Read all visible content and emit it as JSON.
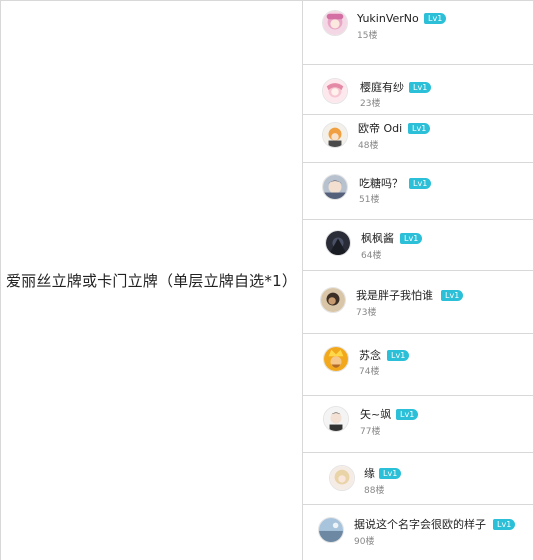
{
  "prize": "爱丽丝立牌或卡门立牌（单层立牌自选*1）",
  "winners": [
    {
      "name": "YukinVerNo",
      "level": "Lv1",
      "floor": "15楼",
      "avatar": "anime-girl-pink-hair-avatar"
    },
    {
      "name": "樱庭有纱",
      "level": "Lv1",
      "floor": "23楼",
      "avatar": "anime-girl-pink-avatar"
    },
    {
      "name": "欧帝 Odi",
      "level": "Lv1",
      "floor": "48楼",
      "avatar": "anime-character-orange-avatar"
    },
    {
      "name": "吃糖吗？",
      "level": "Lv1",
      "floor": "51楼",
      "avatar": "anime-boy-avatar"
    },
    {
      "name": "枫枫酱",
      "level": "Lv1",
      "floor": "64楼",
      "avatar": "dark-anime-avatar"
    },
    {
      "name": "我是胖子我怕谁",
      "level": "Lv1",
      "floor": "73楼",
      "avatar": "character-dark-avatar"
    },
    {
      "name": "苏念",
      "level": "Lv1",
      "floor": "74楼",
      "avatar": "clash-of-clans-king-avatar"
    },
    {
      "name": "矢~飒",
      "level": "Lv1",
      "floor": "77楼",
      "avatar": "anime-boy-white-avatar"
    },
    {
      "name": "缘",
      "level": "Lv1",
      "floor": "88楼",
      "avatar": "blonde-girl-avatar"
    },
    {
      "name": "据说这个名字会很欧的样子",
      "level": "Lv1",
      "floor": "90楼",
      "avatar": "landscape-avatar"
    }
  ],
  "colors": {
    "level_badge": "#2bbfd8",
    "border": "#d8d8d8",
    "floor_text": "#888888"
  }
}
